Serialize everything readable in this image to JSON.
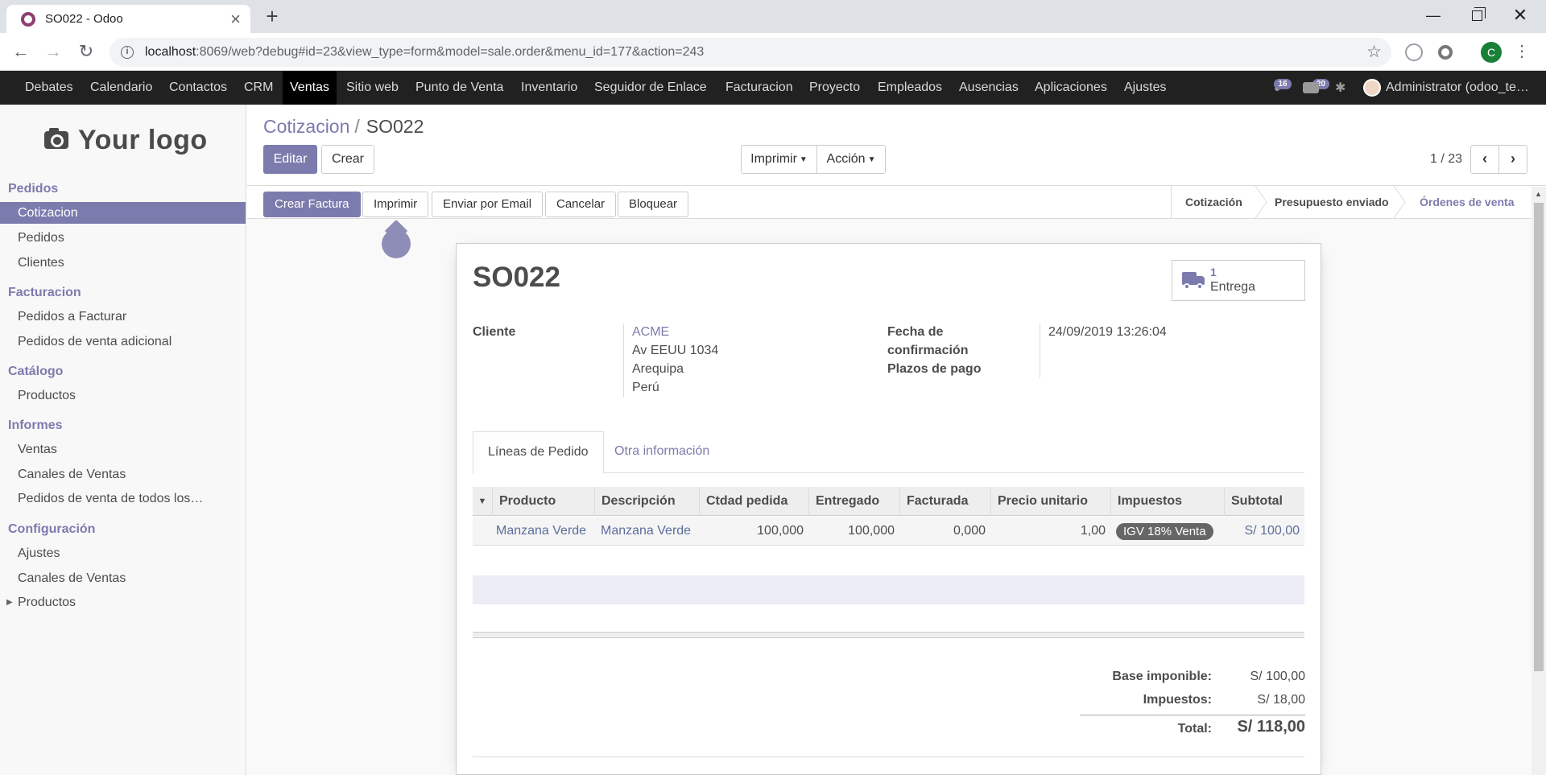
{
  "browser": {
    "tab_title": "SO022 - Odoo",
    "url_host": "localhost",
    "url_path": ":8069/web?debug#id=23&view_type=form&model=sale.order&menu_id=177&action=243",
    "profile_initial": "C"
  },
  "topnav": {
    "items": [
      "Debates",
      "Calendario",
      "Contactos",
      "CRM",
      "Ventas",
      "Sitio web",
      "Punto de Venta",
      "Inventario",
      "Seguidor de Enlace",
      "Facturacion",
      "Proyecto",
      "Empleados",
      "Ausencias",
      "Aplicaciones",
      "Ajustes"
    ],
    "active": "Ventas",
    "activity_count": "16",
    "message_count": "20",
    "user": "Administrator (odoo_te…"
  },
  "sidebar": {
    "logo_text": "Your logo",
    "sections": [
      {
        "title": "Pedidos",
        "items": [
          "Cotizacion",
          "Pedidos",
          "Clientes"
        ]
      },
      {
        "title": "Facturacion",
        "items": [
          "Pedidos a Facturar",
          "Pedidos de venta adicional"
        ]
      },
      {
        "title": "Catálogo",
        "items": [
          "Productos"
        ]
      },
      {
        "title": "Informes",
        "items": [
          "Ventas",
          "Canales de Ventas",
          "Pedidos de venta de todos los…"
        ]
      },
      {
        "title": "Configuración",
        "items": [
          "Ajustes",
          "Canales de Ventas",
          "Productos"
        ]
      }
    ],
    "active_item": "Cotizacion"
  },
  "control": {
    "breadcrumb_parent": "Cotizacion",
    "breadcrumb_sep": "/",
    "breadcrumb_current": "SO022",
    "edit_label": "Editar",
    "create_label": "Crear",
    "print_label": "Imprimir",
    "action_label": "Acción",
    "pager": "1 / 23"
  },
  "statusbar": {
    "buttons": [
      "Crear Factura",
      "Imprimir",
      "Enviar por Email",
      "Cancelar",
      "Bloquear"
    ],
    "stages": [
      "Cotización",
      "Presupuesto enviado",
      "Órdenes de venta"
    ],
    "current_stage": "Órdenes de venta"
  },
  "form": {
    "name": "SO022",
    "delivery_count": "1",
    "delivery_label": "Entrega",
    "customer_label": "Cliente",
    "customer_name": "ACME",
    "customer_address": [
      "Av EEUU 1034",
      "Arequipa",
      "Perú"
    ],
    "confirmation_label_1": "Fecha de",
    "confirmation_label_2": "confirmación",
    "confirmation_date": "24/09/2019 13:26:04",
    "payment_terms_label": "Plazos de pago",
    "tabs": [
      "Líneas de Pedido",
      "Otra información"
    ],
    "lines": {
      "columns": [
        "Producto",
        "Descripción",
        "Ctdad pedida",
        "Entregado",
        "Facturada",
        "Precio unitario",
        "Impuestos",
        "Subtotal"
      ],
      "rows": [
        {
          "product": "Manzana Verde",
          "description": "Manzana Verde",
          "qty": "100,000",
          "delivered": "100,000",
          "invoiced": "0,000",
          "price": "1,00",
          "tax": "IGV 18% Venta",
          "subtotal": "S/ 100,00"
        }
      ]
    },
    "totals": {
      "base_label": "Base imponible:",
      "base_value": "S/ 100,00",
      "tax_label": "Impuestos:",
      "tax_value": "S/ 18,00",
      "total_label": "Total:",
      "total_value": "S/ 118,00"
    }
  },
  "colors": {
    "brand": "#7c7bad",
    "nav_bg": "#212121"
  }
}
